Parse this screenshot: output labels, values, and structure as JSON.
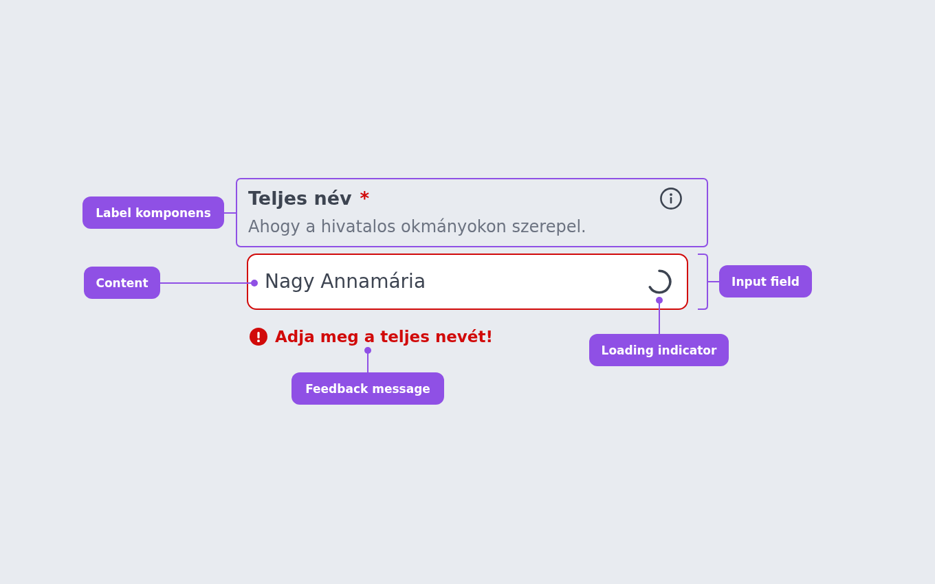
{
  "field": {
    "label": "Teljes név",
    "required_mark": "*",
    "hint": "Ahogy a hivatalos okmányokon szerepel.",
    "value": "Nagy Annamária",
    "loading": true,
    "invalid": true,
    "feedback": "Adja meg a teljes nevét!"
  },
  "annotations": [
    {
      "kind": "label",
      "text": "Label komponens"
    },
    {
      "kind": "content",
      "text": "Content"
    },
    {
      "kind": "input",
      "text": "Input field"
    },
    {
      "kind": "loading",
      "text": "Loading indicator"
    },
    {
      "kind": "feedback",
      "text": "Feedback message"
    }
  ]
}
